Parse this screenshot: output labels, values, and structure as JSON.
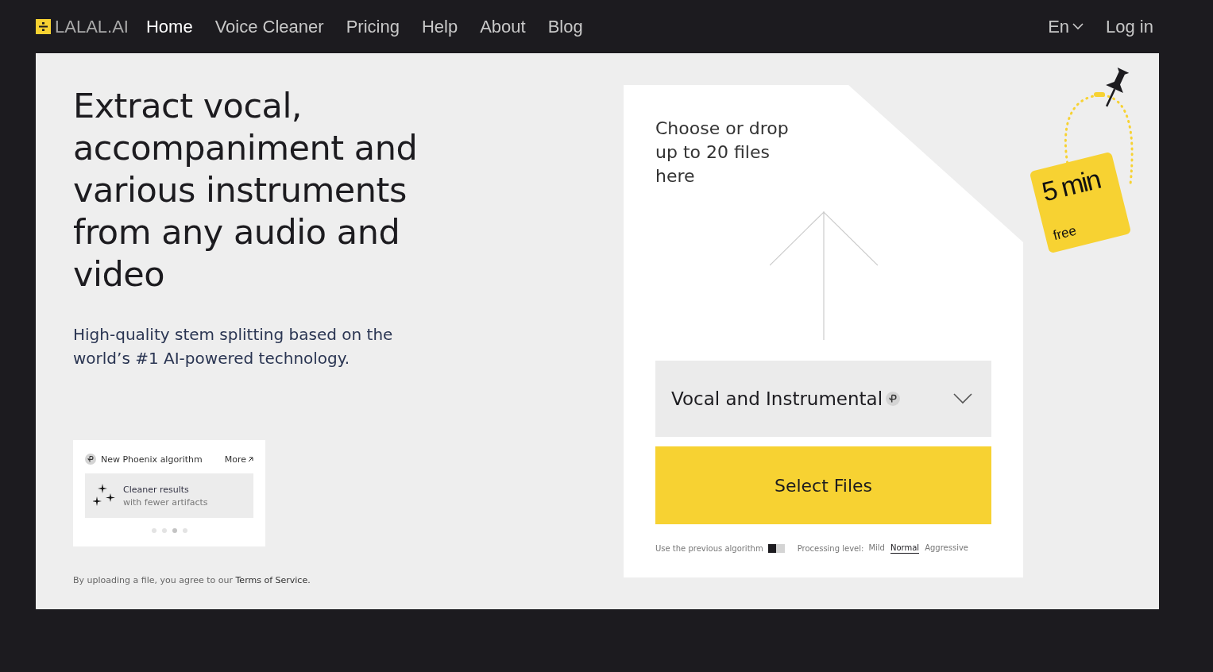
{
  "nav": {
    "logo": "LALAL.AI",
    "links": [
      {
        "label": "Home",
        "selected": true
      },
      {
        "label": "Voice Cleaner",
        "selected": false
      },
      {
        "label": "Pricing",
        "selected": false
      },
      {
        "label": "Help",
        "selected": false
      },
      {
        "label": "About",
        "selected": false
      },
      {
        "label": "Blog",
        "selected": false
      }
    ],
    "language": "En",
    "login": "Log in"
  },
  "hero": {
    "title": "Extract vocal, accompaniment and various instruments from any audio and video",
    "subtitle": "High-quality stem splitting based on the world’s #1 AI-powered technology."
  },
  "promo": {
    "title": "New Phoenix algorithm",
    "more": "More",
    "card_title": "Cleaner results",
    "card_text": "with fewer artifacts",
    "dots": [
      {
        "selected": false
      },
      {
        "selected": false
      },
      {
        "selected": true
      },
      {
        "selected": false
      }
    ]
  },
  "terms": {
    "text": "By uploading a file, you agree to our",
    "link": "Terms of Service."
  },
  "upload": {
    "prompt": "Choose or drop up to 20 files here",
    "stem": "Vocal and Instrumental",
    "button": "Select Files",
    "previous_algorithm": {
      "label": "Use the previous algorithm",
      "on": false
    },
    "processing_label": "Processing level:",
    "levels": [
      {
        "label": "Mild",
        "selected": false
      },
      {
        "label": "Normal",
        "selected": true
      },
      {
        "label": "Aggressive",
        "selected": false
      }
    ]
  },
  "tag": {
    "amount": "5 min",
    "note": "free"
  }
}
